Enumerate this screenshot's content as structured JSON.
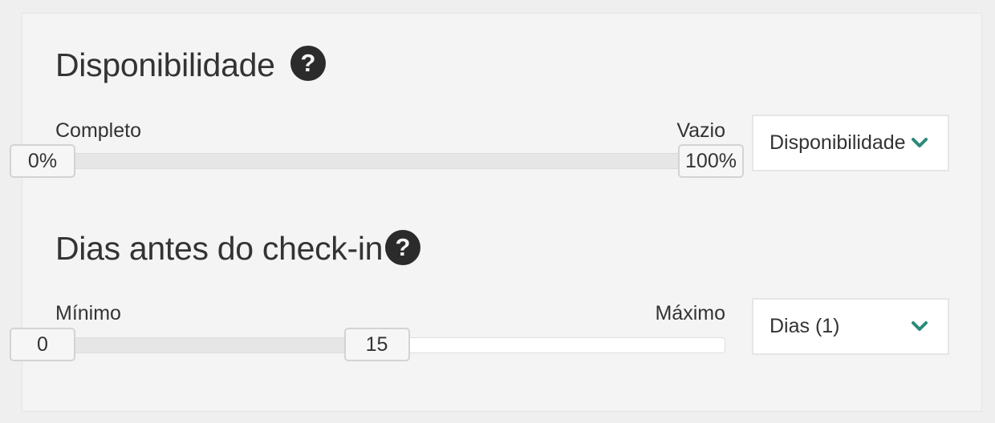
{
  "colors": {
    "accent": "#2a8a7a",
    "help_icon": "#2b2b2b"
  },
  "availability": {
    "title": "Disponibilidade",
    "help_icon": "question-circle-icon",
    "left_label": "Completo",
    "right_label": "Vazio",
    "min_handle": "0%",
    "max_handle": "100%",
    "range_start_fraction": 0,
    "range_end_fraction": 1,
    "select_value": "Disponibilidade"
  },
  "days": {
    "title": "Dias antes do check-in",
    "help_icon": "question-circle-icon",
    "left_label": "Mínimo",
    "right_label": "Máximo",
    "min_handle": "0",
    "max_handle": "15",
    "range_start_fraction": 0,
    "range_end_fraction": 0.5,
    "select_value": "Dias (1)"
  }
}
